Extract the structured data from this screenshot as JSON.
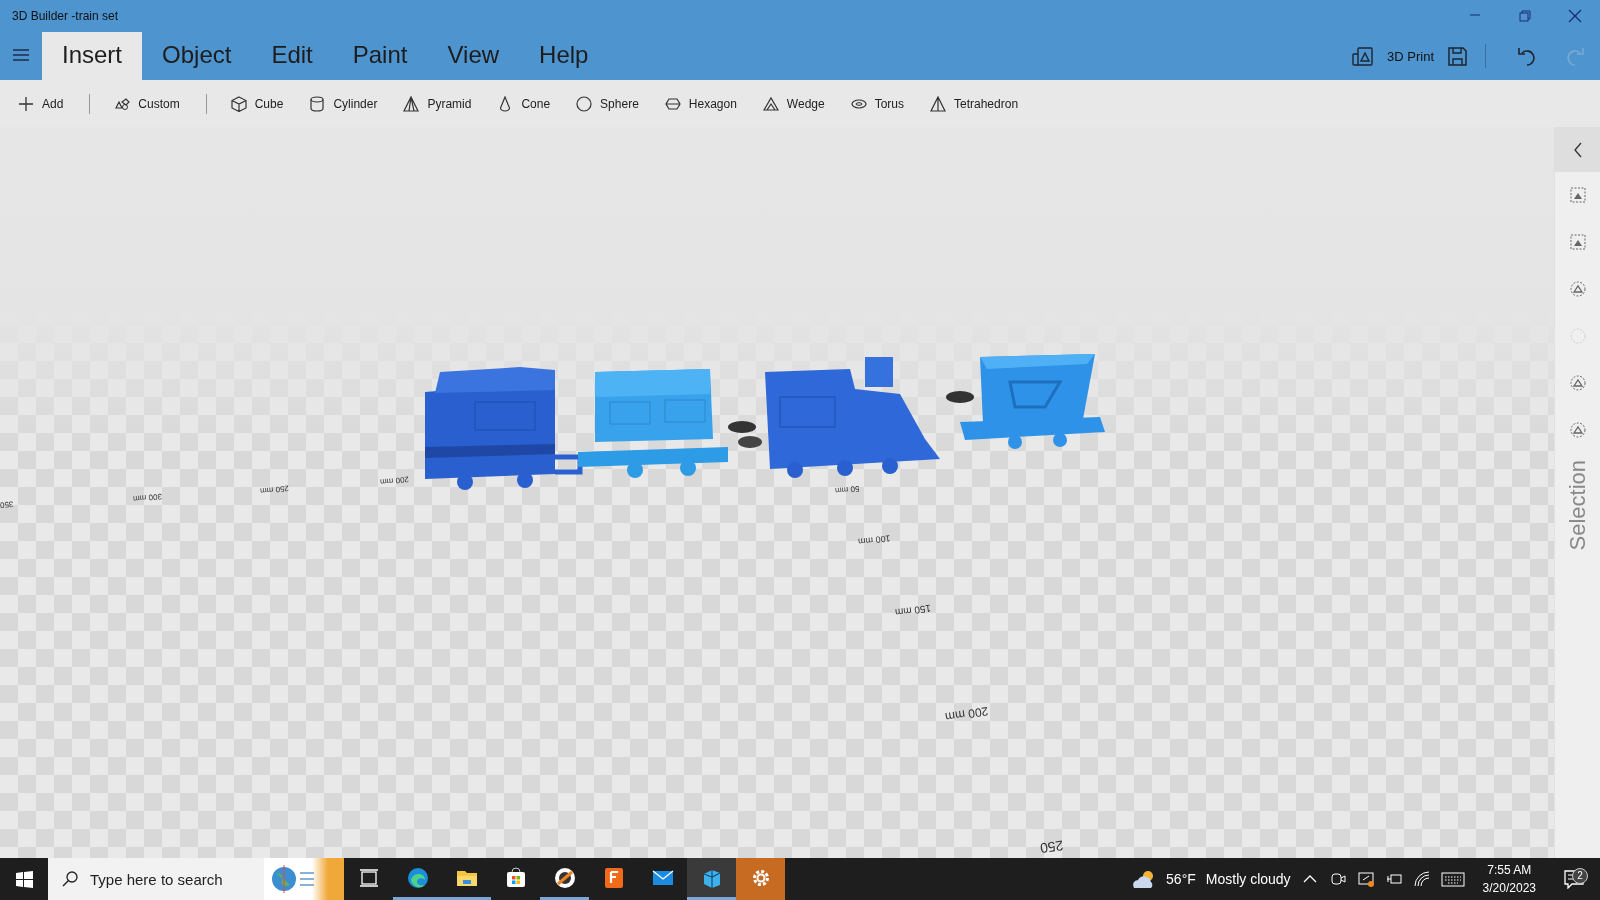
{
  "window": {
    "title": "3D Builder -train set"
  },
  "menu_tabs": [
    {
      "label": "Insert",
      "selected": true
    },
    {
      "label": "Object",
      "selected": false
    },
    {
      "label": "Edit",
      "selected": false
    },
    {
      "label": "Paint",
      "selected": false
    },
    {
      "label": "View",
      "selected": false
    },
    {
      "label": "Help",
      "selected": false
    }
  ],
  "actions": {
    "print_label": "3D Print",
    "undo_disabled": false,
    "redo_disabled": true
  },
  "toolbar": [
    {
      "kind": "add",
      "label": "Add"
    },
    {
      "kind": "custom",
      "label": "Custom"
    },
    {
      "kind": "cube",
      "label": "Cube"
    },
    {
      "kind": "cylinder",
      "label": "Cylinder"
    },
    {
      "kind": "pyramid",
      "label": "Pyramid"
    },
    {
      "kind": "cone",
      "label": "Cone"
    },
    {
      "kind": "sphere",
      "label": "Sphere"
    },
    {
      "kind": "hexagon",
      "label": "Hexagon"
    },
    {
      "kind": "wedge",
      "label": "Wedge"
    },
    {
      "kind": "torus",
      "label": "Torus"
    },
    {
      "kind": "tetrahedron",
      "label": "Tetrahedron"
    }
  ],
  "ground_labels": [
    "50 mm",
    "100 mm",
    "150 mm",
    "200 mm",
    "200 mm",
    "250 mm",
    "300 mm",
    "350",
    "250"
  ],
  "side_panel": {
    "title": "Selection",
    "tools": [
      {
        "disabled": false
      },
      {
        "disabled": false
      },
      {
        "disabled": false
      },
      {
        "disabled": true
      },
      {
        "disabled": false
      },
      {
        "disabled": false
      }
    ]
  },
  "taskbar": {
    "search_placeholder": "Type here to search",
    "apps": [
      {
        "kind": "taskview",
        "running": false,
        "selected": false
      },
      {
        "kind": "edge",
        "running": true,
        "selected": false
      },
      {
        "kind": "explorer",
        "running": true,
        "selected": false
      },
      {
        "kind": "store",
        "running": false,
        "selected": false
      },
      {
        "kind": "orbit",
        "running": true,
        "selected": false
      },
      {
        "kind": "fusion",
        "running": false,
        "selected": false
      },
      {
        "kind": "mail",
        "running": false,
        "selected": false
      },
      {
        "kind": "builder",
        "running": true,
        "selected": true
      },
      {
        "kind": "settings",
        "running": false,
        "selected": false
      }
    ],
    "temperature": "56°F",
    "weather": "Mostly cloudy",
    "time": "7:55 AM",
    "date": "3/20/2023",
    "notifications": "2"
  }
}
